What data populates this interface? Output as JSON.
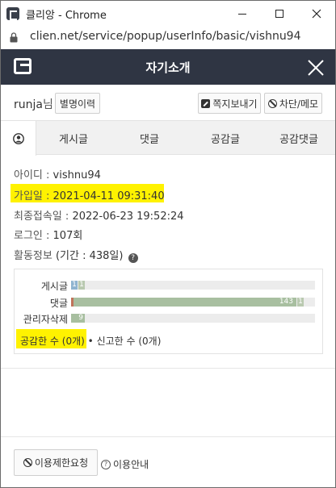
{
  "window": {
    "title": "클리앙 - Chrome",
    "url": "clien.net/service/popup/userInfo/basic/vishnu94"
  },
  "header": {
    "title": "자기소개"
  },
  "user": {
    "name": "runja",
    "suffix": "님",
    "history_button": "별명이력",
    "message_button": "쪽지보내기",
    "block_button": "차단/메모"
  },
  "tabs": {
    "posts": "게시글",
    "comments": "댓글",
    "likes": "공감글",
    "like_comments": "공감댓글"
  },
  "info": {
    "id_label": "아이디 : ",
    "id_value": "vishnu94",
    "joined_label": "가입일 : ",
    "joined_value": "2021-04-11 09:31:40",
    "last_login_label": "최종접속일 : ",
    "last_login_value": "2022-06-23 19:52:24",
    "login_label": "로그인 : ",
    "login_value": "107회",
    "activity_label": "활동정보 ",
    "activity_value": "(기간 : 438일)"
  },
  "stats": {
    "rows": [
      {
        "label": "게시글",
        "segments": [
          "1",
          "1"
        ]
      },
      {
        "label": "댓글",
        "segments": [
          "143",
          "1"
        ]
      },
      {
        "label": "관리자삭제",
        "segments": [
          "9"
        ]
      }
    ],
    "liked_count": "공감한 수 (0개)",
    "separator": "•",
    "reported_count": "신고한 수 (0개)"
  },
  "footer": {
    "restrict_button": "이용제한요청",
    "guide_link": "이용안내"
  },
  "colors": {
    "header_bg": "#2f3543",
    "highlight": "#fff200",
    "bar_blue": "#8fb4d0",
    "bar_green": "#a8bfa0",
    "bar_red": "#c0735a"
  }
}
